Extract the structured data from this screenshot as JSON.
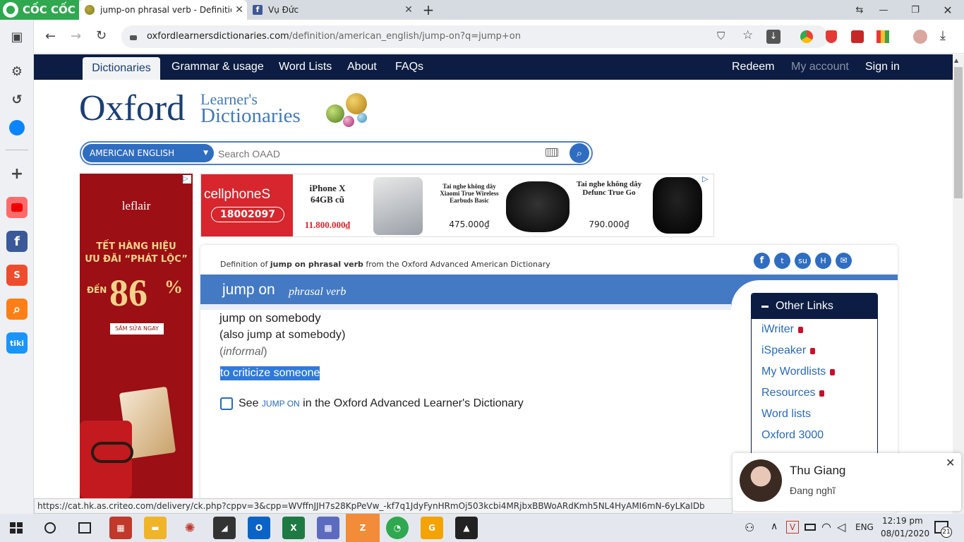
{
  "browser": {
    "brand": "CỐC CỐC",
    "tabs": [
      {
        "title": "jump-on phrasal verb - Definition, pict"
      },
      {
        "title": "Vụ Đức"
      }
    ],
    "address": {
      "host": "oxfordlearnersdictionaries.com",
      "path": "/definition/american_english/jump-on?q=jump+on"
    },
    "status_url": "https://cat.hk.as.criteo.com/delivery/ck.php?cppv=3&cpp=WVffnJJH7s28KpPeVw_-kf7q1JdyFynHRmOj503kcbi4MRjbxBBWoARdKmh5NL4HyAMI6mN-6yLKaIDb"
  },
  "site_nav": {
    "left": [
      "Dictionaries",
      "Grammar & usage",
      "Word Lists",
      "About",
      "FAQs"
    ],
    "right": [
      "Redeem",
      "My account",
      "Sign in"
    ]
  },
  "logo": {
    "oxford": "Oxford",
    "line1": "Learner's",
    "line2": "Dictionaries"
  },
  "search": {
    "language": "AMERICAN ENGLISH",
    "placeholder": "Search OAAD"
  },
  "ads": {
    "left": {
      "brand": "leflair",
      "line1": "TẾT HÀNG HIỆU",
      "line2": "ƯU ĐÃI “PHÁT LỘC”",
      "upto": "ĐẾN",
      "percent": "86",
      "percent_sign": "%",
      "cta": "SĂM SỬA NGAY"
    },
    "top": {
      "brand": "cellphoneS",
      "phone": "18002097",
      "p1_name": "iPhone X 64GB cũ",
      "p1_price": "11.800.000₫",
      "p2_name": "Tai nghe không dây Xiaomi True Wireless Earbuds Basic",
      "p2_price": "475.000₫",
      "p3_name": "Tai nghe không dây Defunc True Go",
      "p3_price": "790.000₫"
    }
  },
  "entry": {
    "crumb_prefix": "Definition of",
    "crumb_word": "jump on phrasal verb",
    "crumb_suffix": "from the Oxford Advanced American Dictionary",
    "headword": "jump on",
    "pos": "phrasal verb",
    "sense": "jump on somebody",
    "also_prefix": "(also",
    "also_term": "jump at somebody",
    "also_suffix": ")",
    "label_open": "(",
    "label": "informal",
    "label_close": ")",
    "definition": "to criticize someone",
    "see_prefix": "See",
    "see_link": "JUMP ON",
    "see_suffix": "in the Oxford Advanced Learner's Dictionary"
  },
  "other_links": {
    "title": "Other Links",
    "items": [
      "iWriter",
      "iSpeaker",
      "My Wordlists",
      "Resources",
      "Word lists",
      "Oxford 3000"
    ]
  },
  "chat": {
    "name": "Thu Giang",
    "status": "Đang nghĩ"
  },
  "taskbar": {
    "lang": "ENG",
    "time": "12:19 pm",
    "date": "08/01/2020",
    "notif": "21"
  },
  "colors": {
    "nav_bg": "#0c1c42",
    "brand_blue": "#1b3f73",
    "headword_band": "#4479c4",
    "link": "#2a6ab5",
    "lock": "#c8102e"
  }
}
